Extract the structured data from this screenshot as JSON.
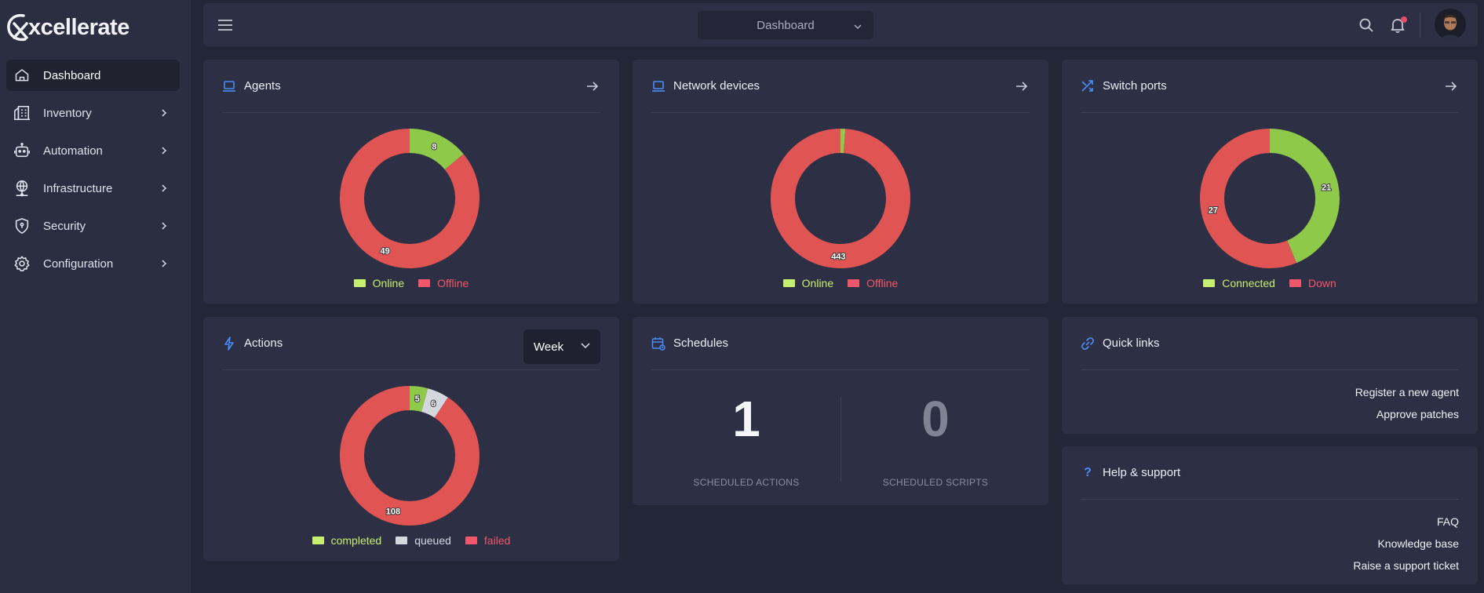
{
  "app": {
    "logo_text": "xcellerate"
  },
  "sidebar": {
    "items": [
      {
        "label": "Dashboard",
        "icon": "home-icon"
      },
      {
        "label": "Inventory",
        "icon": "building-icon"
      },
      {
        "label": "Automation",
        "icon": "robot-icon"
      },
      {
        "label": "Infrastructure",
        "icon": "globe-network-icon"
      },
      {
        "label": "Security",
        "icon": "shield-icon"
      },
      {
        "label": "Configuration",
        "icon": "gear-icon"
      }
    ]
  },
  "header": {
    "view_select": "Dashboard"
  },
  "colors": {
    "green": "#8ec94a",
    "red": "#e05453",
    "grey": "#d5d7de",
    "accent_blue": "#4a8cf7",
    "legend_green": "#c6ef6f",
    "legend_red": "#f2566a"
  },
  "agents": {
    "title": "Agents",
    "legend": [
      "Online",
      "Offline"
    ],
    "chart_data": {
      "type": "pie",
      "categories": [
        "Online",
        "Offline"
      ],
      "values": [
        8,
        49
      ]
    }
  },
  "network_devices": {
    "title": "Network devices",
    "legend": [
      "Online",
      "Offline"
    ],
    "chart_data": {
      "type": "pie",
      "categories": [
        "Online",
        "Offline"
      ],
      "values": [
        5,
        443
      ],
      "data_labels": [
        "",
        "443"
      ]
    }
  },
  "switch_ports": {
    "title": "Switch ports",
    "legend": [
      "Connected",
      "Down"
    ],
    "chart_data": {
      "type": "pie",
      "categories": [
        "Connected",
        "Down"
      ],
      "values": [
        21,
        27
      ]
    }
  },
  "actions": {
    "title": "Actions",
    "period": "Week",
    "legend": [
      "completed",
      "queued",
      "failed"
    ],
    "chart_data": {
      "type": "pie",
      "categories": [
        "completed",
        "queued",
        "failed"
      ],
      "values": [
        5,
        6,
        108
      ]
    }
  },
  "schedules": {
    "title": "Schedules",
    "actions_count": "1",
    "actions_label": "SCHEDULED ACTIONS",
    "scripts_count": "0",
    "scripts_label": "SCHEDULED SCRIPTS"
  },
  "quick_links": {
    "title": "Quick links",
    "links": [
      "Register a new agent",
      "Approve patches"
    ]
  },
  "help": {
    "title": "Help & support",
    "icon_glyph": "?",
    "links": [
      "FAQ",
      "Knowledge base",
      "Raise a support ticket"
    ]
  }
}
